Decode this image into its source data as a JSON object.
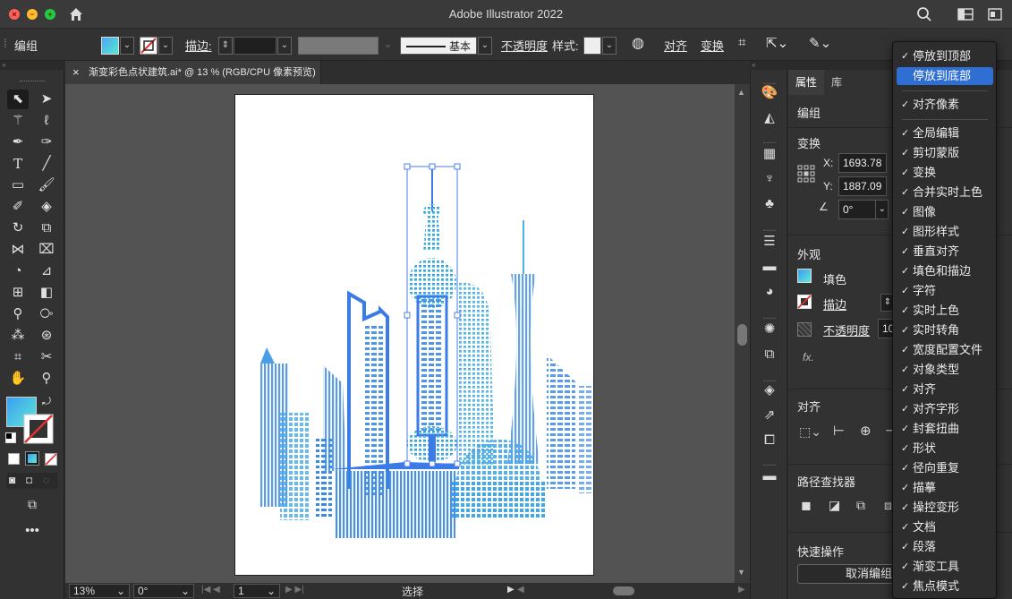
{
  "app": {
    "title": "Adobe Illustrator 2022"
  },
  "controlbar": {
    "selection_type": "编组",
    "stroke_label": "描边:",
    "stroke_profile": "基本",
    "opacity_label": "不透明度",
    "style_label": "样式:",
    "align_label": "对齐",
    "transform_label": "变换"
  },
  "document": {
    "tab_title": "渐变彩色点状建筑.ai* @ 13 % (RGB/CPU 像素预览)",
    "close_glyph": "×"
  },
  "statusbar": {
    "zoom": "13%",
    "rotation": "0°",
    "artboard_index": "1",
    "tool_status": "选择"
  },
  "properties": {
    "tabs": [
      {
        "label": "属性"
      },
      {
        "label": "库"
      }
    ],
    "selection_type": "编组",
    "transform": {
      "title": "变换",
      "x_label": "X:",
      "x_value": "1693.78",
      "y_label": "Y:",
      "y_value": "1887.09",
      "angle_value": "0°"
    },
    "appearance": {
      "title": "外观",
      "fill_label": "填色",
      "stroke_label": "描边",
      "opacity_label": "不透明度",
      "opacity_value": "10",
      "fx_label": "fx."
    },
    "align_title": "对齐",
    "pathfinder_title": "路径查找器",
    "quick_actions": {
      "title": "快速操作",
      "ungroup_label": "取消编组"
    }
  },
  "menu": {
    "items_top": [
      {
        "label": "停放到顶部",
        "checked": true
      },
      {
        "label": "停放到底部",
        "checked": false,
        "highlighted": true
      }
    ],
    "items_mid": [
      {
        "label": "对齐像素",
        "checked": true
      }
    ],
    "items_bottom": [
      {
        "label": "全局编辑"
      },
      {
        "label": "剪切蒙版"
      },
      {
        "label": "变换"
      },
      {
        "label": "合并实时上色"
      },
      {
        "label": "图像"
      },
      {
        "label": "图形样式"
      },
      {
        "label": "垂直对齐"
      },
      {
        "label": "填色和描边"
      },
      {
        "label": "字符"
      },
      {
        "label": "实时上色"
      },
      {
        "label": "实时转角"
      },
      {
        "label": "宽度配置文件"
      },
      {
        "label": "对象类型"
      },
      {
        "label": "对齐"
      },
      {
        "label": "对齐字形"
      },
      {
        "label": "封套扭曲"
      },
      {
        "label": "形状"
      },
      {
        "label": "径向重复"
      },
      {
        "label": "描摹"
      },
      {
        "label": "操控变形"
      },
      {
        "label": "文档"
      },
      {
        "label": "段落"
      },
      {
        "label": "渐变工具"
      },
      {
        "label": "焦点模式"
      }
    ],
    "check_glyph": "✓"
  },
  "colors": {
    "accent": "#2f6fd4",
    "gradient_start": "#3b7be8",
    "gradient_end": "#5fe8d8"
  }
}
